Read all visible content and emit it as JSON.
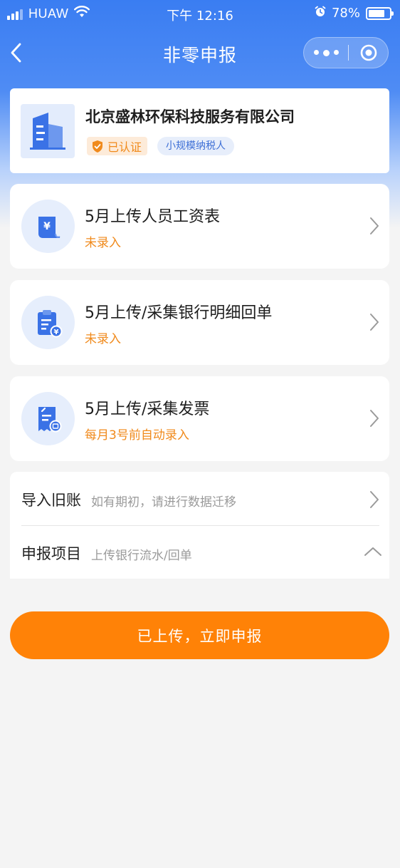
{
  "status_bar": {
    "carrier": "HUAW",
    "time": "下午 12:16",
    "battery_percent": "78%",
    "battery_level": 0.78
  },
  "nav": {
    "title": "非零申报",
    "icons": [
      "back-arrow-icon",
      "more-dots-icon",
      "target-circle-icon"
    ]
  },
  "company": {
    "name": "北京盛林环保科技服务有限公司",
    "verified_label": "已认证",
    "taxpayer_type": "小规模纳税人",
    "icon": "building-icon"
  },
  "tasks": [
    {
      "title": "5月上传人员工资表",
      "status": "未录入",
      "icon": "payroll-receipt-icon"
    },
    {
      "title": "5月上传/采集银行明细回单",
      "status": "未录入",
      "icon": "bank-clipboard-icon"
    },
    {
      "title": "5月上传/采集发票",
      "status": "每月3号前自动录入",
      "icon": "invoice-icon"
    }
  ],
  "list": [
    {
      "label": "导入旧账",
      "sub": "如有期初，请进行数据迁移",
      "icon": "chevron-right-icon"
    },
    {
      "label": "申报项目",
      "sub": "上传银行流水/回单",
      "icon": "chevron-up-icon"
    }
  ],
  "primary_button": {
    "label": "已上传，立即申报"
  },
  "colors": {
    "brand_blue": "#3a7df2",
    "accent_orange": "#ff8207",
    "status_orange": "#f08a1c",
    "background": "#f4f4f4"
  }
}
